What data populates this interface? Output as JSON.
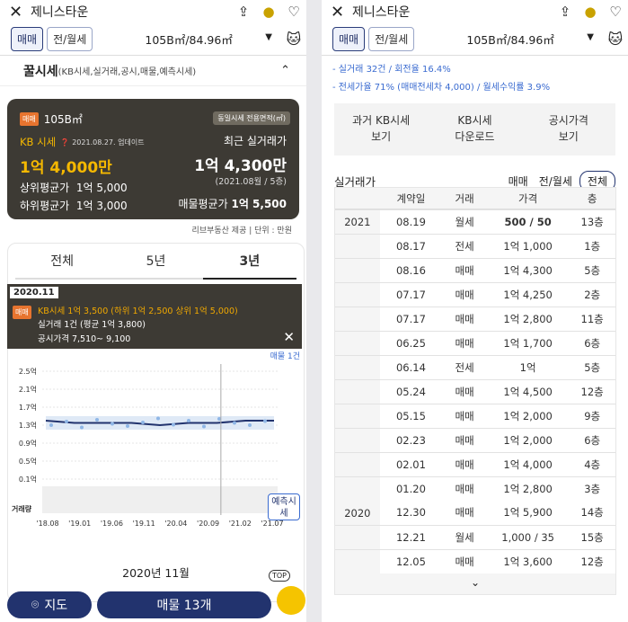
{
  "app": {
    "title": "제니스타운",
    "close_icon": "close-icon",
    "share_icon": "share-icon",
    "coin_icon": "coin-icon",
    "heart_icon": "heart-icon"
  },
  "tabs": {
    "sale": "매매",
    "rent": "전/월세",
    "area": "105B㎡/84.96㎡"
  },
  "left": {
    "section_title": "꿀시세",
    "section_sub": "(KB시세,실거래,공시,매물,예측시세)",
    "card": {
      "badge": "매매",
      "area": "105B㎡",
      "area_note": "동일시세 전용면적(㎡)",
      "kb_label": "KB 시세",
      "kb_date": "2021.08.27. 업데이트",
      "recent_label": "최근 실거래가",
      "kb_price": "1억 4,000만",
      "recent_price": "1억 4,300만",
      "recent_sub": "(2021.08월 / 5층)",
      "upper_label": "상위평균가",
      "upper_val": "1억 5,000",
      "lower_label": "하위평균가",
      "lower_val": "1억 3,000",
      "listing_label": "매물평균가",
      "listing_val": "1억 5,500"
    },
    "source": "리브부동산 제공 | 단위 : 만원",
    "period_tabs": [
      "전체",
      "5년",
      "3년"
    ],
    "tooltip": {
      "date": "2020.11",
      "badge": "매매",
      "line1": "KB시세 1억 3,500 (하위 1억 2,500 상위 1억 5,000)",
      "line2": "실거래 1건 (평균 1억 3,800)",
      "line3": "공시가격 7,510~ 9,100"
    },
    "listing_link": "매물 1건",
    "predict_label": "예측시세",
    "volume_label": "거래량",
    "selected_month": "2020년 11월",
    "top_label": "TOP",
    "map_btn": "지도",
    "listing_btn": "매물 13개"
  },
  "chart_data": {
    "type": "line",
    "yticks": [
      "2.5억",
      "2.1억",
      "1.7억",
      "1.3억",
      "0.9억",
      "0.5억",
      "0.1억"
    ],
    "ylim": [
      0.1,
      2.5
    ],
    "xticks": [
      "'18.08",
      "'19.01",
      "'19.06",
      "'19.11",
      "'20.04",
      "'20.09",
      "'21.02",
      "'21.07"
    ],
    "series": [
      {
        "name": "KB시세",
        "x": [
          "'18.08",
          "'19.01",
          "'19.06",
          "'19.11",
          "'20.04",
          "'20.09",
          "'21.02",
          "'21.07",
          "'21.08"
        ],
        "values": [
          1.4,
          1.35,
          1.35,
          1.35,
          1.3,
          1.35,
          1.35,
          1.4,
          1.4
        ]
      }
    ],
    "selected_x": "'20.11"
  },
  "right": {
    "info1": "- 실거래 32건 / 회전율 16.4%",
    "info2": "- 전세가율 71% (매매전세차 4,000) / 월세수익률 3.9%",
    "actions": [
      [
        "과거 KB시세",
        "보기"
      ],
      [
        "KB시세",
        "다운로드"
      ],
      [
        "공시가격",
        "보기"
      ]
    ],
    "trade_title": "실거래가",
    "filters": [
      "매매",
      "전/월세",
      "전체"
    ],
    "cols": [
      "계약일",
      "거래",
      "가격",
      "층"
    ],
    "rows": [
      {
        "yr": "2021",
        "dt": "08.19",
        "ty": "월세",
        "pr": "500 / 50",
        "fl": "13층",
        "bold": true
      },
      {
        "yr": "",
        "dt": "08.17",
        "ty": "전세",
        "pr": "1억 1,000",
        "fl": "1층"
      },
      {
        "yr": "",
        "dt": "08.16",
        "ty": "매매",
        "pr": "1억 4,300",
        "fl": "5층"
      },
      {
        "yr": "",
        "dt": "07.17",
        "ty": "매매",
        "pr": "1억 4,250",
        "fl": "2층"
      },
      {
        "yr": "",
        "dt": "07.17",
        "ty": "매매",
        "pr": "1억 2,800",
        "fl": "11층"
      },
      {
        "yr": "",
        "dt": "06.25",
        "ty": "매매",
        "pr": "1억 1,700",
        "fl": "6층"
      },
      {
        "yr": "",
        "dt": "06.14",
        "ty": "전세",
        "pr": "1억",
        "fl": "5층"
      },
      {
        "yr": "",
        "dt": "05.24",
        "ty": "매매",
        "pr": "1억 4,500",
        "fl": "12층"
      },
      {
        "yr": "",
        "dt": "05.15",
        "ty": "매매",
        "pr": "1억 2,000",
        "fl": "9층"
      },
      {
        "yr": "",
        "dt": "02.23",
        "ty": "매매",
        "pr": "1억 2,000",
        "fl": "6층"
      },
      {
        "yr": "",
        "dt": "02.01",
        "ty": "매매",
        "pr": "1억 4,000",
        "fl": "4층"
      },
      {
        "yr": "",
        "dt": "01.20",
        "ty": "매매",
        "pr": "1억 2,800",
        "fl": "3층"
      },
      {
        "yr": "2020",
        "dt": "12.30",
        "ty": "매매",
        "pr": "1억 5,900",
        "fl": "14층"
      },
      {
        "yr": "",
        "dt": "12.21",
        "ty": "월세",
        "pr": "1,000 / 35",
        "fl": "15층"
      },
      {
        "yr": "",
        "dt": "12.05",
        "ty": "매매",
        "pr": "1억 3,600",
        "fl": "12층"
      }
    ],
    "more_icon": "chevron-down-icon"
  }
}
